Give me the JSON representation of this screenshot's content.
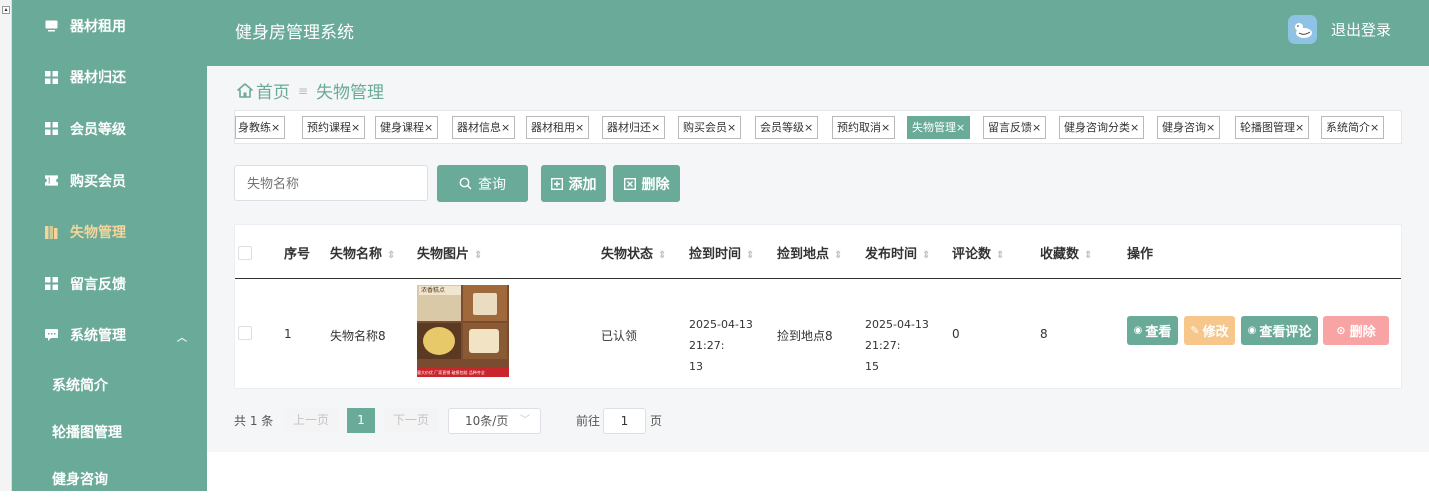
{
  "app": {
    "title": "健身房管理系统",
    "logout_label": "退出登录"
  },
  "sidebar": {
    "items": [
      {
        "label": "器材租用",
        "icon": "monitor-icon"
      },
      {
        "label": "器材归还",
        "icon": "grid-icon"
      },
      {
        "label": "会员等级",
        "icon": "grid-icon"
      },
      {
        "label": "购买会员",
        "icon": "ticket-icon"
      },
      {
        "label": "失物管理",
        "icon": "book-icon"
      },
      {
        "label": "留言反馈",
        "icon": "grid-icon"
      },
      {
        "label": "系统管理",
        "icon": "chat-icon"
      }
    ],
    "subitems": [
      "系统简介",
      "轮播图管理",
      "健身咨询"
    ],
    "active_color": "#f4d49a",
    "bg_color": "#6aaa98"
  },
  "breadcrumb": {
    "home": "首页",
    "separator": "≡",
    "current": "失物管理"
  },
  "tabs": [
    "身教练",
    "预约课程",
    "健身课程",
    "器材信息",
    "器材租用",
    "器材归还",
    "购买会员",
    "会员等级",
    "预约取消",
    "失物管理",
    "留言反馈",
    "健身咨询分类",
    "健身咨询",
    "轮播图管理",
    "系统简介"
  ],
  "tab_close": "×",
  "toolbar": {
    "search_placeholder": "失物名称",
    "search_label": "查询",
    "add_label": "添加",
    "delete_label": "删除"
  },
  "table": {
    "headers": {
      "index": "序号",
      "name": "失物名称",
      "image": "失物图片",
      "status": "失物状态",
      "found_time": "捡到时间",
      "found_place": "捡到地点",
      "publish_time": "发布时间",
      "comments": "评论数",
      "favorites": "收藏数",
      "actions": "操作"
    },
    "rows": [
      {
        "index": "1",
        "name": "失物名称8",
        "status": "已认领",
        "found_time_l1": "2025-04-13 21:27:",
        "found_time_l2": "13",
        "found_place": "捡到地点8",
        "publish_time_l1": "2025-04-13 21:27:",
        "publish_time_l2": "15",
        "comments": "0",
        "favorites": "8",
        "image_top_text": "浓香糕点",
        "image_bottom_text": "量大价优 厂家直销 破损包赔 品种齐全"
      }
    ],
    "actions": {
      "view": "查看",
      "edit": "修改",
      "view_comments": "查看评论",
      "delete": "删除"
    }
  },
  "pagination": {
    "total": "共 1 条",
    "prev": "上一页",
    "current_page": "1",
    "next": "下一页",
    "page_size": "10条/页",
    "goto_label": "前往",
    "goto_value": "1",
    "page_suffix": "页"
  },
  "colors": {
    "primary": "#6aaa98",
    "edit": "#f6c68a",
    "danger": "#f8a4a4"
  }
}
